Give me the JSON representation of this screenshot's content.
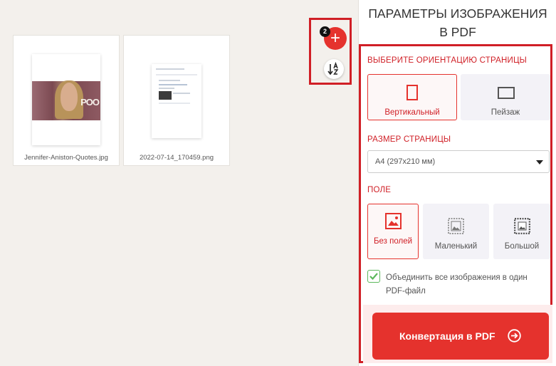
{
  "workspace": {
    "files": [
      {
        "name": "Jennifer-Aniston-Quotes.jpg"
      },
      {
        "name": "2022-07-14_170459.png"
      }
    ],
    "add_badge": "2",
    "add_icon": "+",
    "photo_logo": "POO"
  },
  "panel": {
    "title_line1": "ПАРАМЕТРЫ ИЗОБРАЖЕНИЯ",
    "title_line2": "В PDF",
    "orientation": {
      "label": "ВЫБЕРИТЕ ОРИЕНТАЦИЮ СТРАНИЦЫ",
      "options": [
        {
          "label": "Вертикальный",
          "icon": "portrait-page-icon",
          "selected": true
        },
        {
          "label": "Пейзаж",
          "icon": "landscape-page-icon",
          "selected": false
        }
      ]
    },
    "page_size": {
      "label": "РАЗМЕР СТРАНИЦЫ",
      "value": "A4 (297x210 мм)"
    },
    "margin": {
      "label": "ПОЛЕ",
      "options": [
        {
          "label": "Без полей",
          "icon": "no-margin-image-icon",
          "selected": true
        },
        {
          "label": "Маленький",
          "icon": "small-margin-image-icon",
          "selected": false
        },
        {
          "label": "Большой",
          "icon": "large-margin-image-icon",
          "selected": false
        }
      ]
    },
    "merge": {
      "checked": true,
      "label": "Объединить все изображения в один PDF-файл"
    },
    "convert_label": "Конвертация в PDF"
  },
  "colors": {
    "accent": "#e5322d",
    "highlight": "#d01f26",
    "check": "#5cb85c"
  }
}
